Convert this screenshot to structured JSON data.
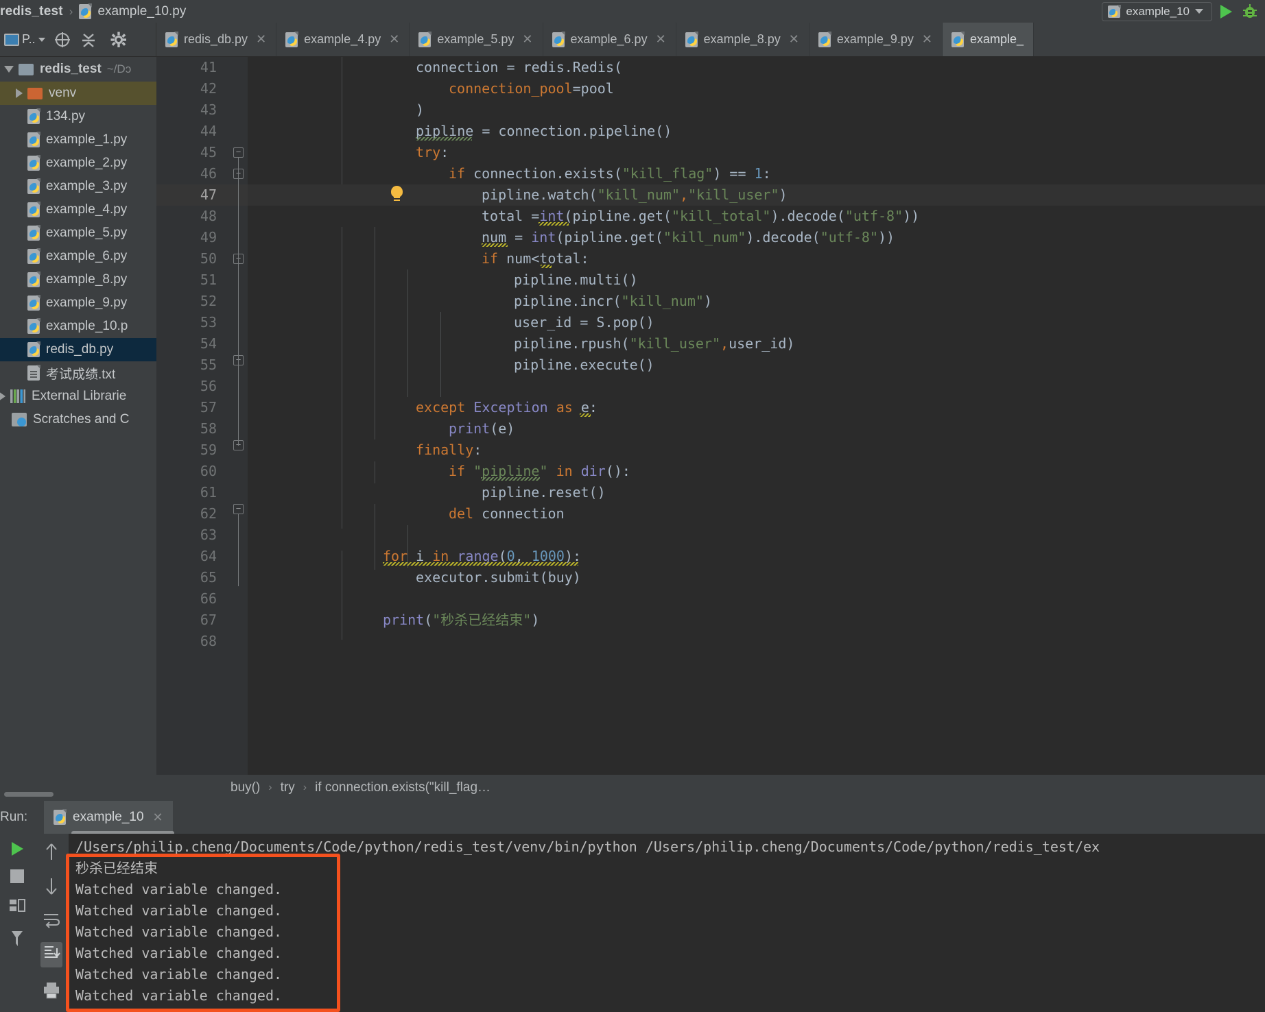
{
  "navbar": {
    "project": "redis_test",
    "separator": "›",
    "file": "example_10.py",
    "run_config": "example_10",
    "run_icon": "python-file-icon",
    "play_icon": "run-icon",
    "debug_icon": "debug-icon"
  },
  "toolbar": {
    "project_label": "P..",
    "target_icon": "target-icon",
    "collapse_icon": "collapse-all-icon",
    "settings_icon": "gear-icon"
  },
  "tabs": [
    {
      "label": "redis_db.py",
      "active": false
    },
    {
      "label": "example_4.py",
      "active": false
    },
    {
      "label": "example_5.py",
      "active": false
    },
    {
      "label": "example_6.py",
      "active": false
    },
    {
      "label": "example_8.py",
      "active": false
    },
    {
      "label": "example_9.py",
      "active": false
    },
    {
      "label": "example_",
      "active": true
    }
  ],
  "sidebar": {
    "root": {
      "label": "redis_test",
      "path_suffix": "~/Dɔ",
      "icon": "folder-icon"
    },
    "items": [
      {
        "label": "venv",
        "icon": "folder-orange-icon",
        "type": "folder",
        "indent": 1,
        "selected": true,
        "expandable": true
      },
      {
        "label": "134.py",
        "icon": "python-file-icon",
        "type": "file",
        "indent": 2
      },
      {
        "label": "example_1.py",
        "icon": "python-file-icon",
        "type": "file",
        "indent": 2
      },
      {
        "label": "example_2.py",
        "icon": "python-file-icon",
        "type": "file",
        "indent": 2
      },
      {
        "label": "example_3.py",
        "icon": "python-file-icon",
        "type": "file",
        "indent": 2
      },
      {
        "label": "example_4.py",
        "icon": "python-file-icon",
        "type": "file",
        "indent": 2
      },
      {
        "label": "example_5.py",
        "icon": "python-file-icon",
        "type": "file",
        "indent": 2
      },
      {
        "label": "example_6.py",
        "icon": "python-file-icon",
        "type": "file",
        "indent": 2
      },
      {
        "label": "example_8.py",
        "icon": "python-file-icon",
        "type": "file",
        "indent": 2
      },
      {
        "label": "example_9.py",
        "icon": "python-file-icon",
        "type": "file",
        "indent": 2
      },
      {
        "label": "example_10.p",
        "icon": "python-file-icon",
        "type": "file",
        "indent": 2
      },
      {
        "label": "redis_db.py",
        "icon": "python-file-icon",
        "type": "file",
        "indent": 2,
        "selected": true
      },
      {
        "label": "考试成绩.txt",
        "icon": "text-file-icon",
        "type": "file",
        "indent": 2
      }
    ],
    "externals": [
      {
        "label": "External Librarie",
        "icon": "library-icon"
      },
      {
        "label": "Scratches and C",
        "icon": "scratches-icon"
      }
    ]
  },
  "editor": {
    "first_line": 41,
    "cursor_line": 47,
    "lines": [
      {
        "n": 41,
        "text": "    connection = redis.Redis("
      },
      {
        "n": 42,
        "text": "        connection_pool=pool"
      },
      {
        "n": 43,
        "text": "    )"
      },
      {
        "n": 44,
        "text": "    pipline = connection.pipeline()"
      },
      {
        "n": 45,
        "text": "    try:"
      },
      {
        "n": 46,
        "text": "        if connection.exists(\"kill_flag\") == 1:"
      },
      {
        "n": 47,
        "text": "            pipline.watch(\"kill_num\",\"kill_user\")"
      },
      {
        "n": 48,
        "text": "            total =int(pipline.get(\"kill_total\").decode(\"utf-8\"))"
      },
      {
        "n": 49,
        "text": "            num = int(pipline.get(\"kill_num\").decode(\"utf-8\"))"
      },
      {
        "n": 50,
        "text": "            if num<total:"
      },
      {
        "n": 51,
        "text": "                pipline.multi()"
      },
      {
        "n": 52,
        "text": "                pipline.incr(\"kill_num\")"
      },
      {
        "n": 53,
        "text": "                user_id = S.pop()"
      },
      {
        "n": 54,
        "text": "                pipline.rpush(\"kill_user\",user_id)"
      },
      {
        "n": 55,
        "text": "                pipline.execute()"
      },
      {
        "n": 56,
        "text": ""
      },
      {
        "n": 57,
        "text": "    except Exception as e:"
      },
      {
        "n": 58,
        "text": "        print(e)"
      },
      {
        "n": 59,
        "text": "    finally:"
      },
      {
        "n": 60,
        "text": "        if \"pipline\" in dir():"
      },
      {
        "n": 61,
        "text": "            pipline.reset()"
      },
      {
        "n": 62,
        "text": "        del connection"
      },
      {
        "n": 63,
        "text": ""
      },
      {
        "n": 64,
        "text": "for i in range(0, 1000):"
      },
      {
        "n": 65,
        "text": "    executor.submit(buy)"
      },
      {
        "n": 66,
        "text": ""
      },
      {
        "n": 67,
        "text": "print(\"秒杀已经结束\")"
      },
      {
        "n": 68,
        "text": ""
      }
    ],
    "breadcrumbs": [
      "buy()",
      "try",
      "if connection.exists(\"kill_flag…"
    ],
    "breadcrumb_sep": "›"
  },
  "run_panel": {
    "label": "Run:",
    "tab_label": "example_10",
    "tab_icon": "python-file-icon",
    "close_icon": "close-icon",
    "toolbar_icons": [
      "rerun-icon",
      "stop-icon",
      "up-arrow-icon",
      "down-arrow-icon",
      "soft-wrap-icon",
      "scroll-to-end-icon",
      "print-icon",
      "pin-icon"
    ],
    "console_lines": [
      {
        "text": "/Users/philip.cheng/Documents/Code/python/redis_test/venv/bin/python /Users/philip.cheng/Documents/Code/python/redis_test/ex",
        "kind": "path"
      },
      {
        "text": "秒杀已经结束",
        "kind": "cn"
      },
      {
        "text": "Watched variable changed.",
        "kind": "out"
      },
      {
        "text": "Watched variable changed.",
        "kind": "out"
      },
      {
        "text": "Watched variable changed.",
        "kind": "out"
      },
      {
        "text": "Watched variable changed.",
        "kind": "out"
      },
      {
        "text": "Watched variable changed.",
        "kind": "out"
      },
      {
        "text": "Watched variable changed.",
        "kind": "out"
      }
    ],
    "highlight_color": "#f4511e"
  }
}
